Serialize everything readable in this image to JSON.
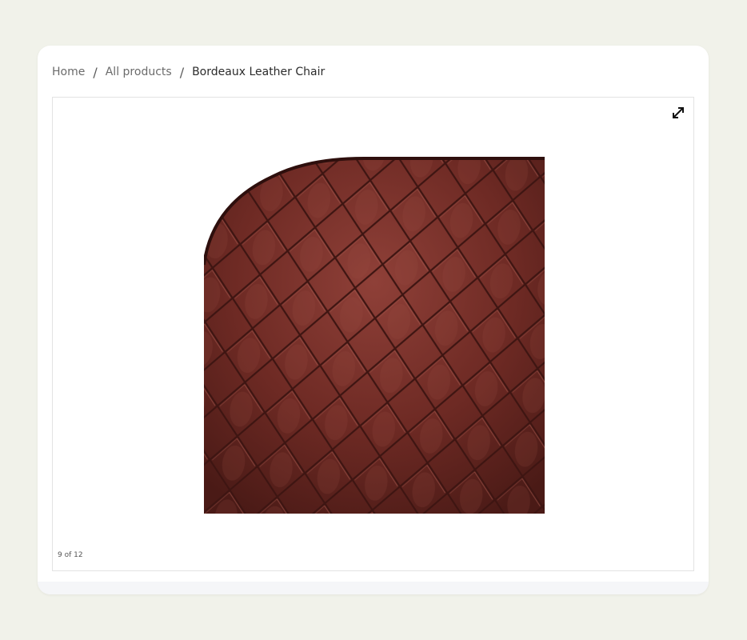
{
  "breadcrumb": {
    "home": "Home",
    "all_products": "All products",
    "current": "Bordeaux Leather Chair",
    "separator": "/"
  },
  "gallery": {
    "counter": "9 of 12",
    "current_index": 9,
    "total": 12,
    "expand_icon": "expand-arrows-icon",
    "image_subject": "quilted burgundy leather"
  },
  "colors": {
    "background": "#f1f2ea",
    "leather_base": "#6e2a24",
    "leather_light": "#8f4038",
    "leather_dark": "#3e1512"
  }
}
